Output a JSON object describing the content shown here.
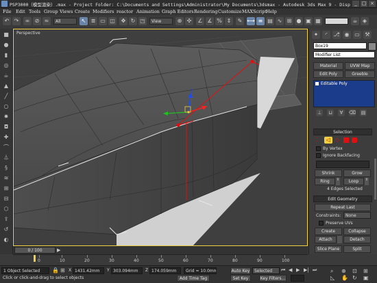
{
  "window": {
    "title": "PSP3000（模型渲染）.max     - Project Folder: C:\\Documents and Settings\\Administrator\\My Documents\\3dsmax     - Autodesk 3ds Max 9     - Disp"
  },
  "menu": [
    "File",
    "Edit",
    "Tools",
    "Group",
    "Views",
    "Create",
    "Modifiers",
    "reactor",
    "Animation",
    "Graph Editors",
    "Rendering",
    "Customize",
    "MAXScript",
    "Help"
  ],
  "toolbar": {
    "selection_filter": "All",
    "coord_system": "View"
  },
  "viewport": {
    "label": "Perspective"
  },
  "command_panel": {
    "object_name": "Box19",
    "modifier_list": "Modifier List",
    "buttons": [
      "Material",
      "UVW Map",
      "Edit Poly",
      "Greeble"
    ],
    "stack_item": "Editable Poly",
    "selection": {
      "title": "Selection",
      "by_vertex": "By Vertex",
      "ignore_backfacing": "Ignore Backfacing",
      "shrink": "Shrink",
      "grow": "Grow",
      "ring": "Ring",
      "loop": "Loop",
      "status": "4 Edges Selected"
    },
    "edit_geometry": {
      "title": "Edit Geometry",
      "repeat_last": "Repeat Last",
      "constraints_label": "Constraints:",
      "constraints_value": "None",
      "preserve_uvs": "Preserve UVs",
      "create": "Create",
      "collapse": "Collapse",
      "attach": "Attach",
      "detach": "Detach",
      "slice_plane": "Slice Plane",
      "split": "Split"
    }
  },
  "timeline": {
    "slider": "0 / 100",
    "ticks": [
      "0",
      "10",
      "20",
      "30",
      "40",
      "50",
      "60",
      "70",
      "80",
      "90",
      "100"
    ]
  },
  "status": {
    "selected": "1 Object Selected",
    "prompt": "Click or click-and-drag to select objects",
    "x_label": "X",
    "x": "1431.42mm",
    "y_label": "Y",
    "y": "303.094mm",
    "z_label": "Z",
    "z": "174.059mm",
    "grid": "Grid = 10.0mm",
    "add_time_tag": "Add Time Tag",
    "auto_key": "Auto Key",
    "selected_mode": "Selected",
    "set_key": "Set Key",
    "key_filters": "Key Filters..."
  },
  "colors": {
    "accent": "#f0d040",
    "selection_red": "#e01010",
    "stack_blue": "#1a3c8a",
    "viewport_bg": "#3f3f3f"
  }
}
